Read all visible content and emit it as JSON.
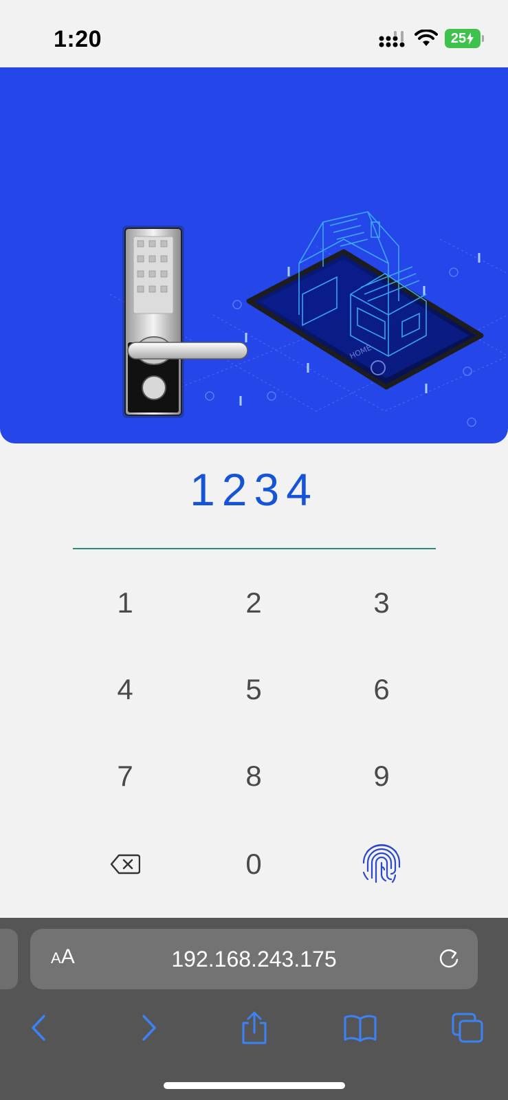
{
  "status": {
    "time": "1:20",
    "battery": "25"
  },
  "pin": {
    "value": "1234"
  },
  "keypad": {
    "k1": "1",
    "k2": "2",
    "k3": "3",
    "k4": "4",
    "k5": "5",
    "k6": "6",
    "k7": "7",
    "k8": "8",
    "k9": "9",
    "k0": "0"
  },
  "browser": {
    "aa_small": "A",
    "aa_large": "A",
    "url": "192.168.243.175"
  },
  "colors": {
    "hero": "#2547ea",
    "pin": "#1553d8",
    "toolbar_icon": "#3b82f6",
    "fingerprint": "#2b48c8"
  }
}
